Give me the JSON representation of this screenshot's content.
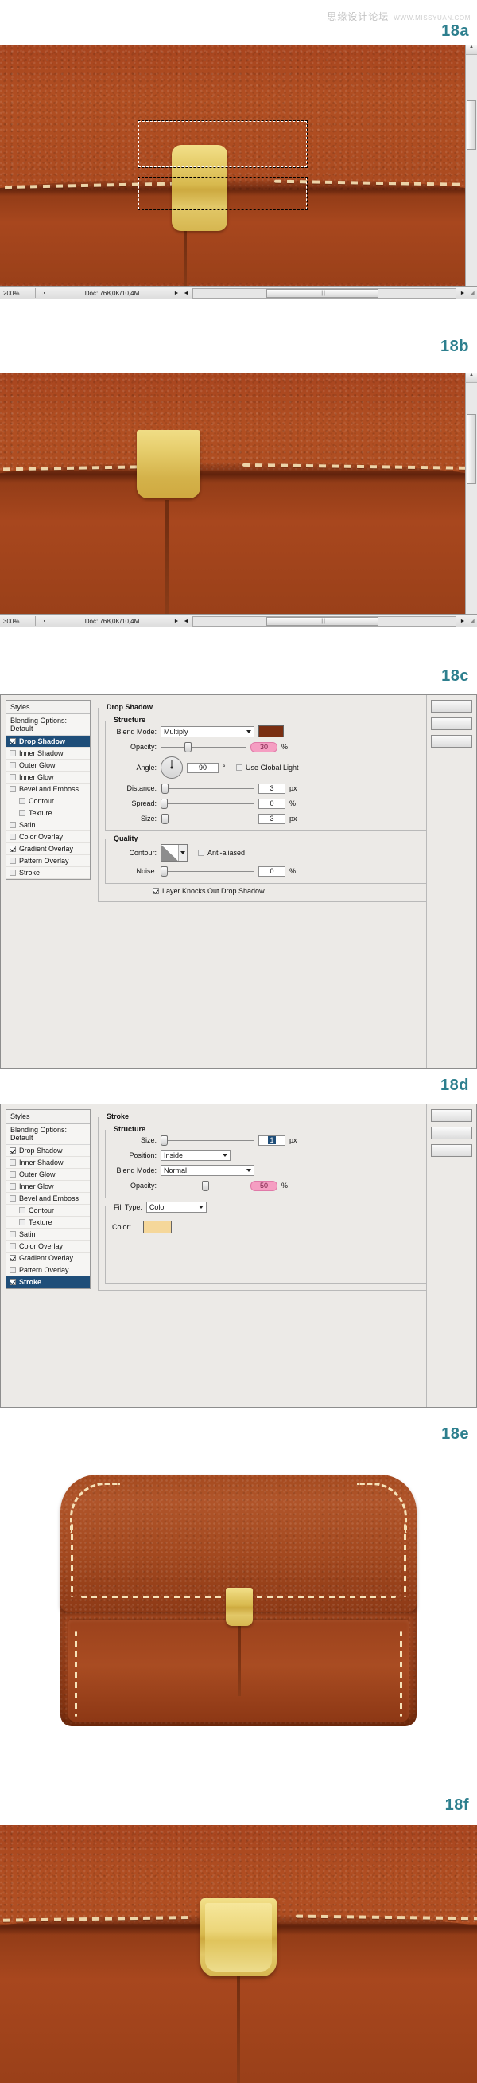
{
  "watermark": {
    "cn": "思缘设计论坛",
    "url": "WWW.MISSYUAN.COM"
  },
  "steps": {
    "a": "18a",
    "b": "18b",
    "c": "18c",
    "d": "18d",
    "e": "18e",
    "f": "18f"
  },
  "canvas_18a": {
    "zoom": "200%",
    "doc": "Doc: 768,0K/10,4M",
    "left_arrow": "◄",
    "right_arrow": "►",
    "thumb_grip": "|||",
    "status_icon": "◔"
  },
  "canvas_18b": {
    "zoom": "300%",
    "doc": "Doc: 768,0K/10,4M",
    "left_arrow": "◄",
    "right_arrow": "►",
    "thumb_grip": "|||",
    "status_icon": "◔"
  },
  "dialog_drop_shadow": {
    "styles_header": "Styles",
    "blending_options": "Blending Options: Default",
    "styles": [
      {
        "label": "Drop Shadow",
        "checked": true,
        "selected": true,
        "indent": false
      },
      {
        "label": "Inner Shadow",
        "checked": false,
        "selected": false,
        "indent": false
      },
      {
        "label": "Outer Glow",
        "checked": false,
        "selected": false,
        "indent": false
      },
      {
        "label": "Inner Glow",
        "checked": false,
        "selected": false,
        "indent": false
      },
      {
        "label": "Bevel and Emboss",
        "checked": false,
        "selected": false,
        "indent": false
      },
      {
        "label": "Contour",
        "checked": false,
        "selected": false,
        "indent": true
      },
      {
        "label": "Texture",
        "checked": false,
        "selected": false,
        "indent": true
      },
      {
        "label": "Satin",
        "checked": false,
        "selected": false,
        "indent": false
      },
      {
        "label": "Color Overlay",
        "checked": false,
        "selected": false,
        "indent": false
      },
      {
        "label": "Gradient Overlay",
        "checked": true,
        "selected": false,
        "indent": false
      },
      {
        "label": "Pattern Overlay",
        "checked": false,
        "selected": false,
        "indent": false
      },
      {
        "label": "Stroke",
        "checked": false,
        "selected": false,
        "indent": false
      }
    ],
    "panel_title": "Drop Shadow",
    "structure_title": "Structure",
    "blend_mode_label": "Blend Mode:",
    "blend_mode_value": "Multiply",
    "blend_color": "#7a2f12",
    "opacity_label": "Opacity:",
    "opacity_value": "30",
    "opacity_unit": "%",
    "angle_label": "Angle:",
    "angle_value": "90",
    "angle_unit": "°",
    "global_light_label": "Use Global Light",
    "distance_label": "Distance:",
    "distance_value": "3",
    "distance_unit": "px",
    "spread_label": "Spread:",
    "spread_value": "0",
    "spread_unit": "%",
    "size_label": "Size:",
    "size_value": "3",
    "size_unit": "px",
    "quality_title": "Quality",
    "contour_label": "Contour:",
    "antialiased_label": "Anti-aliased",
    "noise_label": "Noise:",
    "noise_value": "0",
    "noise_unit": "%",
    "knockout_label": "Layer Knocks Out Drop Shadow",
    "highlight_color": "#f59ec2"
  },
  "dialog_stroke": {
    "styles_header": "Styles",
    "blending_options": "Blending Options: Default",
    "styles": [
      {
        "label": "Drop Shadow",
        "checked": true,
        "selected": false,
        "indent": false
      },
      {
        "label": "Inner Shadow",
        "checked": false,
        "selected": false,
        "indent": false
      },
      {
        "label": "Outer Glow",
        "checked": false,
        "selected": false,
        "indent": false
      },
      {
        "label": "Inner Glow",
        "checked": false,
        "selected": false,
        "indent": false
      },
      {
        "label": "Bevel and Emboss",
        "checked": false,
        "selected": false,
        "indent": false
      },
      {
        "label": "Contour",
        "checked": false,
        "selected": false,
        "indent": true
      },
      {
        "label": "Texture",
        "checked": false,
        "selected": false,
        "indent": true
      },
      {
        "label": "Satin",
        "checked": false,
        "selected": false,
        "indent": false
      },
      {
        "label": "Color Overlay",
        "checked": false,
        "selected": false,
        "indent": false
      },
      {
        "label": "Gradient Overlay",
        "checked": true,
        "selected": false,
        "indent": false
      },
      {
        "label": "Pattern Overlay",
        "checked": false,
        "selected": false,
        "indent": false
      },
      {
        "label": "Stroke",
        "checked": true,
        "selected": true,
        "indent": false
      }
    ],
    "panel_title": "Stroke",
    "structure_title": "Structure",
    "size_label": "Size:",
    "size_value": "1",
    "size_unit": "px",
    "position_label": "Position:",
    "position_value": "Inside",
    "blend_mode_label": "Blend Mode:",
    "blend_mode_value": "Normal",
    "opacity_label": "Opacity:",
    "opacity_value": "50",
    "opacity_unit": "%",
    "fill_type_label": "Fill Type:",
    "fill_type_value": "Color",
    "color_label": "Color:",
    "color_value": "#f5d79a",
    "highlight_color": "#f59ec2"
  }
}
